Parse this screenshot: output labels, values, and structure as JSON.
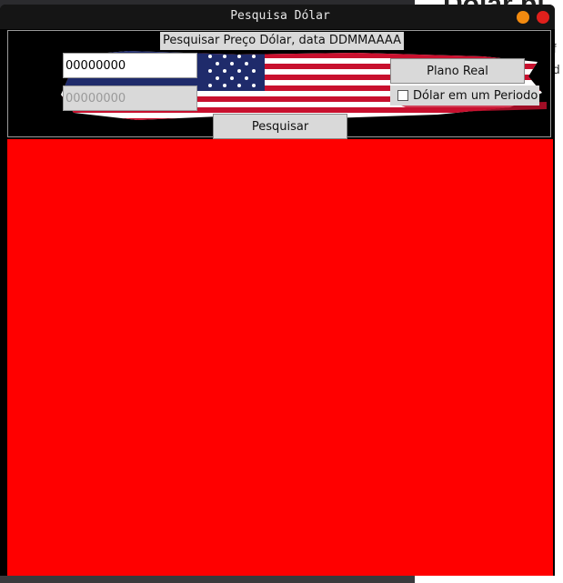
{
  "background": {
    "heading": "Dólar pl",
    "line1": "of",
    "line2": "nd"
  },
  "window": {
    "title": "Pesquisa Dólar",
    "controls": {
      "minimize_color": "#f28a0f",
      "close_color": "#e0201c"
    }
  },
  "form": {
    "header_label": "Pesquisar Preço Dólar, data DDMMAAAA",
    "date_start": {
      "value": "00000000"
    },
    "date_end": {
      "placeholder": "00000000"
    },
    "plano_real_label": "Plano Real",
    "periodo_checkbox_label": "Dólar em um Periodo",
    "periodo_checked": false,
    "search_label": "Pesquisar"
  },
  "result": {
    "background_color": "#ff0000"
  },
  "icons": [
    "us-flag-image",
    "minimize-icon",
    "close-icon",
    "checkbox-icon"
  ]
}
